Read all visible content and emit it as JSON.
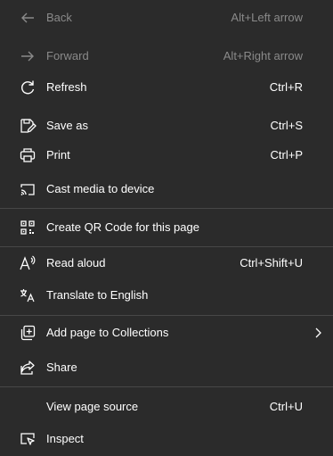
{
  "context_menu": {
    "items": [
      {
        "label": "Back",
        "shortcut": "Alt+Left arrow",
        "icon": "back-arrow-icon",
        "enabled": false
      },
      {
        "label": "Forward",
        "shortcut": "Alt+Right arrow",
        "icon": "forward-arrow-icon",
        "enabled": false
      },
      {
        "label": "Refresh",
        "shortcut": "Ctrl+R",
        "icon": "refresh-icon",
        "enabled": true
      },
      {
        "label": "Save as",
        "shortcut": "Ctrl+S",
        "icon": "save-as-icon",
        "enabled": true
      },
      {
        "label": "Print",
        "shortcut": "Ctrl+P",
        "icon": "print-icon",
        "enabled": true
      },
      {
        "label": "Cast media to device",
        "shortcut": "",
        "icon": "cast-icon",
        "enabled": true
      },
      {
        "label": "Create QR Code for this page",
        "shortcut": "",
        "icon": "qr-code-icon",
        "enabled": true
      },
      {
        "label": "Read aloud",
        "shortcut": "Ctrl+Shift+U",
        "icon": "read-aloud-icon",
        "enabled": true
      },
      {
        "label": "Translate to English",
        "shortcut": "",
        "icon": "translate-icon",
        "enabled": true
      },
      {
        "label": "Add page to Collections",
        "shortcut": "",
        "icon": "collections-icon",
        "enabled": true,
        "submenu": true
      },
      {
        "label": "Share",
        "shortcut": "",
        "icon": "share-icon",
        "enabled": true
      },
      {
        "label": "View page source",
        "shortcut": "Ctrl+U",
        "icon": "",
        "enabled": true
      },
      {
        "label": "Inspect",
        "shortcut": "",
        "icon": "inspect-icon",
        "enabled": true
      }
    ],
    "colors": {
      "background": "#2b2b2b",
      "text": "#ffffff",
      "disabled_text": "#8a8a8a",
      "separator": "#474747"
    }
  }
}
